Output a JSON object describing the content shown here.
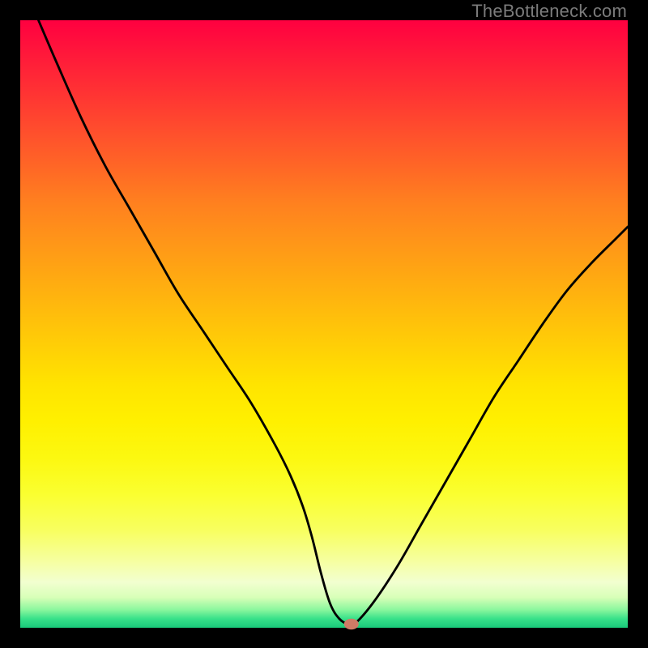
{
  "watermark": "TheBottleneck.com",
  "chart_data": {
    "type": "line",
    "title": "",
    "xlabel": "",
    "ylabel": "",
    "xlim": [
      0,
      100
    ],
    "ylim": [
      0,
      100
    ],
    "grid": false,
    "legend": false,
    "series": [
      {
        "name": "bottleneck-curve",
        "x": [
          3,
          6,
          10,
          14,
          18,
          22,
          26,
          30,
          34,
          38,
          42,
          44.5,
          46.5,
          48,
          49.5,
          51,
          52.5,
          54,
          55,
          58,
          62,
          66,
          70,
          74,
          78,
          82,
          86,
          90,
          94,
          98,
          100
        ],
        "values": [
          100,
          93,
          84,
          76,
          69,
          62,
          55,
          49,
          43,
          37,
          30,
          25,
          20,
          15,
          9,
          4,
          1.5,
          0.6,
          0.6,
          4,
          10,
          17,
          24,
          31,
          38,
          44,
          50,
          55.5,
          60,
          64,
          66
        ]
      }
    ],
    "marker": {
      "x": 54.5,
      "y": 0.6,
      "rx": 1.2,
      "ry": 0.9,
      "label": "optimal-point"
    },
    "background_gradient": {
      "top": "#ff0040",
      "mid": "#ffe400",
      "bottom": "#19c97a"
    }
  }
}
